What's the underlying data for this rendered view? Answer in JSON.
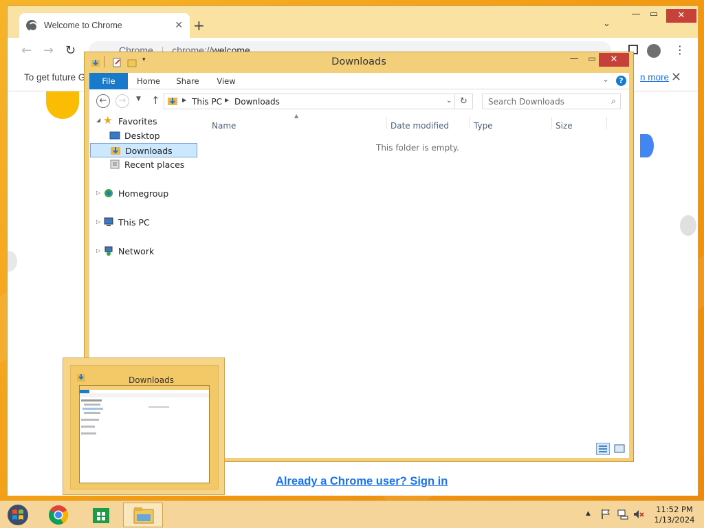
{
  "chrome": {
    "tab_title": "Welcome to Chrome",
    "new_tab": "+",
    "url_scheme": "chrome://",
    "url_host": "welcome",
    "url_prefix": "Chrome",
    "infobar_text": "To get future Go",
    "infobar_link": "n more",
    "signin_link": "Already a Chrome user? Sign in",
    "close_glyph": "✕"
  },
  "explorer": {
    "title": "Downloads",
    "ribbon_tabs": [
      "File",
      "Home",
      "Share",
      "View"
    ],
    "breadcrumb": [
      "This PC",
      "Downloads"
    ],
    "search_placeholder": "Search Downloads",
    "nav": {
      "favorites": "Favorites",
      "desktop": "Desktop",
      "downloads": "Downloads",
      "recent": "Recent places",
      "homegroup": "Homegroup",
      "this_pc": "This PC",
      "network": "Network"
    },
    "columns": [
      "Name",
      "Date modified",
      "Type",
      "Size"
    ],
    "empty_message": "This folder is empty."
  },
  "thumbnail": {
    "title": "Downloads"
  },
  "taskbar": {
    "time": "11:52 PM",
    "date": "1/13/2024"
  },
  "colors": {
    "accent": "#1979ca",
    "window_frame": "#f4cf7a",
    "close_red": "#c7413b",
    "link": "#1a73e8"
  }
}
